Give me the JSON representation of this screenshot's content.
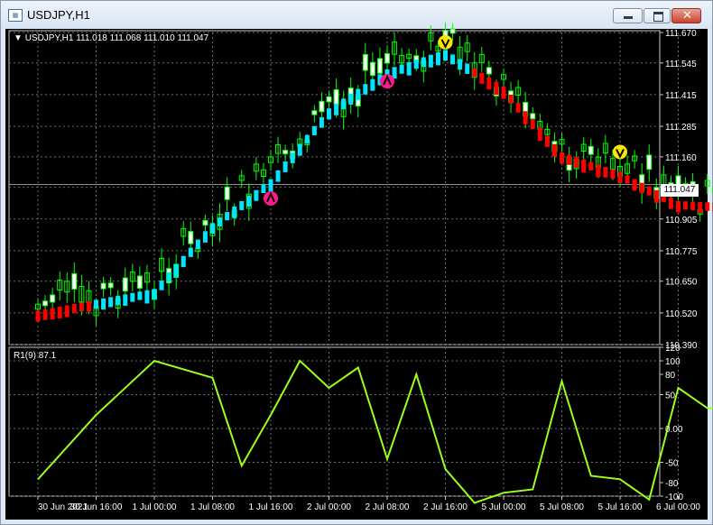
{
  "window": {
    "title": "USDJPY,H1",
    "icons": [
      "chart-window-icon",
      "minimize-icon",
      "maximize-icon",
      "close-icon"
    ]
  },
  "main_chart": {
    "header": "USDJPY,H1  111.018 111.068 111.010 111.047",
    "current_price": "111.047",
    "price_axis": [
      "111.670",
      "111.545",
      "111.415",
      "111.285",
      "111.160",
      "111.035",
      "110.905",
      "110.775",
      "110.650",
      "110.520",
      "110.390"
    ]
  },
  "indicator": {
    "header": "R1(9) 87.1",
    "axis": [
      "120",
      "100",
      "80",
      "50",
      "0.00",
      "-50",
      "-80",
      "-100"
    ]
  },
  "time_axis": [
    "30 Jun 2021",
    "30 Jun 16:00",
    "1 Jul 00:00",
    "1 Jul 08:00",
    "1 Jul 16:00",
    "2 Jul 00:00",
    "2 Jul 08:00",
    "2 Jul 16:00",
    "5 Jul 00:00",
    "5 Jul 08:00",
    "5 Jul 16:00",
    "6 Jul 00:00"
  ],
  "colors": {
    "background": "#000000",
    "grid": "#6e6e6e",
    "bull_candle": "#00ff00",
    "trend_up": "#00e5ff",
    "trend_down": "#ff0000",
    "indicator_line": "#9aff1a",
    "arrow_down": "#ffe600",
    "arrow_up": "#ff1a8c"
  },
  "chart_data": [
    {
      "type": "candlestick",
      "symbol": "USDJPY",
      "timeframe": "H1",
      "open": 111.018,
      "high": 111.068,
      "low": 111.01,
      "close": 111.047,
      "ylim": [
        110.39,
        111.67
      ],
      "grid": true,
      "trend_line": [
        {
          "x": "30 Jun 2021",
          "y": 110.51,
          "trend": "down"
        },
        {
          "x": "30 Jun 16:00",
          "y": 110.6,
          "trend": "up"
        },
        {
          "x": "1 Jul 00:00",
          "y": 110.87,
          "trend": "up"
        },
        {
          "x": "1 Jul 08:00",
          "y": 111.05,
          "trend": "up"
        },
        {
          "x": "1 Jul 16:00",
          "y": 111.34,
          "trend": "up"
        },
        {
          "x": "2 Jul 00:00",
          "y": 111.5,
          "trend": "up"
        },
        {
          "x": "2 Jul 08:00",
          "y": 111.58,
          "trend": "up"
        },
        {
          "x": "2 Jul 16:00",
          "y": 111.43,
          "trend": "down"
        },
        {
          "x": "5 Jul 00:00",
          "y": 111.16,
          "trend": "down"
        },
        {
          "x": "5 Jul 08:00",
          "y": 111.08,
          "trend": "down"
        },
        {
          "x": "5 Jul 16:00",
          "y": 110.96,
          "trend": "down"
        },
        {
          "x": "6 Jul 00:00",
          "y": 110.95,
          "trend": "down"
        }
      ],
      "arrows": [
        {
          "type": "down",
          "x": "2 Jul 08:00",
          "y": 111.63
        },
        {
          "type": "up",
          "x": "1 Jul 08:00",
          "y": 110.99
        },
        {
          "type": "up",
          "x": "2 Jul 00:00",
          "y": 111.47
        },
        {
          "type": "down",
          "x": "5 Jul 08:00",
          "y": 111.18
        },
        {
          "type": "down",
          "x": "6 Jul 00:00",
          "y": 111.05
        }
      ]
    },
    {
      "type": "line",
      "name": "R1(9)",
      "last_value": 87.1,
      "ylim": [
        -100,
        120
      ],
      "x": [
        "30 Jun 2021",
        "30 Jun 08:00",
        "30 Jun 16:00",
        "1 Jul 00:00",
        "1 Jul 04:00",
        "1 Jul 08:00",
        "1 Jul 12:00",
        "1 Jul 16:00",
        "1 Jul 20:00",
        "2 Jul 00:00",
        "2 Jul 04:00",
        "2 Jul 08:00",
        "2 Jul 12:00",
        "2 Jul 16:00",
        "2 Jul 20:00",
        "5 Jul 00:00",
        "5 Jul 04:00",
        "5 Jul 08:00",
        "5 Jul 12:00",
        "5 Jul 16:00",
        "5 Jul 20:00",
        "6 Jul 00:00"
      ],
      "y": [
        -75,
        20,
        100,
        75,
        -55,
        20,
        100,
        60,
        90,
        -45,
        80,
        -60,
        -110,
        -95,
        -90,
        70,
        -70,
        -75,
        -105,
        60,
        30,
        30
      ]
    }
  ]
}
